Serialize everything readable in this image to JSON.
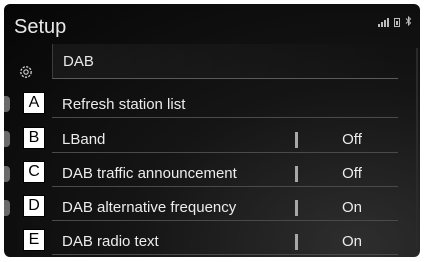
{
  "header": {
    "title": "Setup",
    "status_icons": [
      "signal-bars-icon",
      "battery-icon",
      "bluetooth-icon"
    ]
  },
  "sidebar": {
    "icon": "gear-icon"
  },
  "menu": {
    "section_label": "DAB",
    "items": [
      {
        "callout": "A",
        "label": "Refresh station list",
        "value": ""
      },
      {
        "callout": "B",
        "label": "LBand",
        "value": "Off"
      },
      {
        "callout": "C",
        "label": "DAB traffic announcement",
        "value": "Off"
      },
      {
        "callout": "D",
        "label": "DAB alternative frequency",
        "value": "On"
      },
      {
        "callout": "E",
        "label": "DAB radio text",
        "value": "On"
      }
    ]
  }
}
